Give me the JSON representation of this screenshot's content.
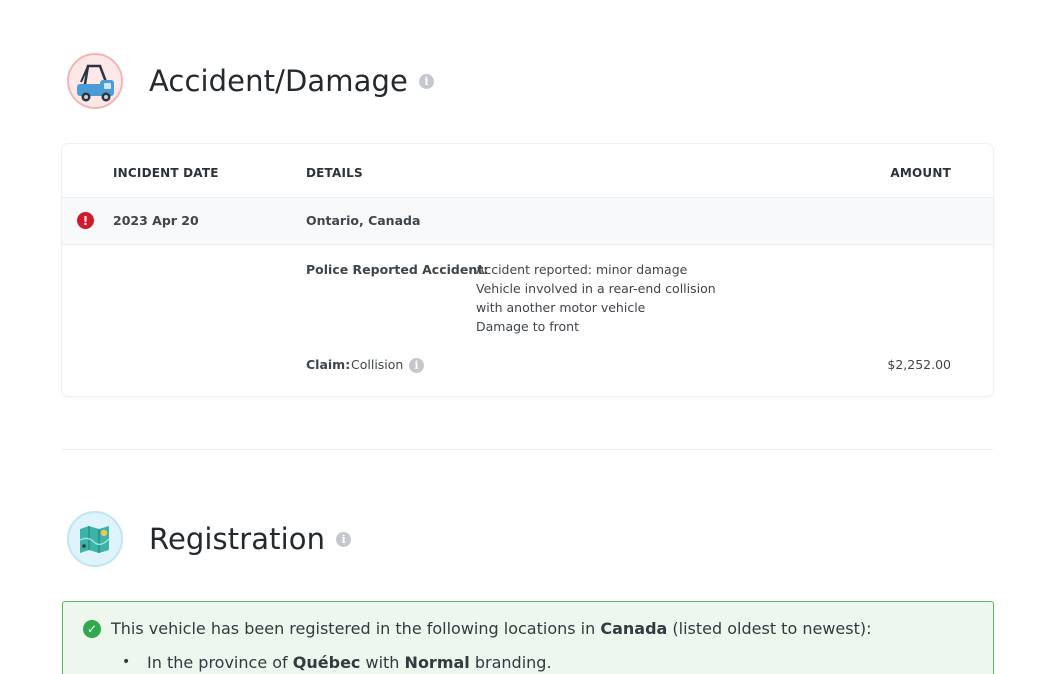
{
  "accident_section": {
    "title": "Accident/Damage",
    "info_icon": "info-icon",
    "table": {
      "headers": {
        "incident_date": "INCIDENT DATE",
        "details": "DETAILS",
        "amount": "AMOUNT"
      },
      "record": {
        "status_icon": "alert-icon",
        "date": "2023 Apr 20",
        "location": "Ontario, Canada",
        "police_label": "Police Reported Accident:",
        "police_lines": [
          "Accident reported: minor damage",
          "Vehicle involved in a rear-end collision",
          "with another motor vehicle",
          "Damage to front"
        ],
        "claim_label": "Claim:",
        "claim_value": "Collision",
        "claim_amount": "$2,252.00"
      }
    }
  },
  "registration_section": {
    "title": "Registration",
    "info_icon": "info-icon",
    "notice": {
      "prefix": "This vehicle has been registered in the following locations in",
      "country": "Canada",
      "suffix": "(listed oldest to newest):"
    },
    "entries": [
      {
        "prefix": "In the province of",
        "province": "Québec",
        "middle": "with",
        "branding": "Normal",
        "suffix": "branding."
      }
    ]
  },
  "colors": {
    "alert": "#d11a2a",
    "success": "#2fa84f",
    "success_border": "#5cb85c",
    "success_bg": "#eef7ed"
  }
}
